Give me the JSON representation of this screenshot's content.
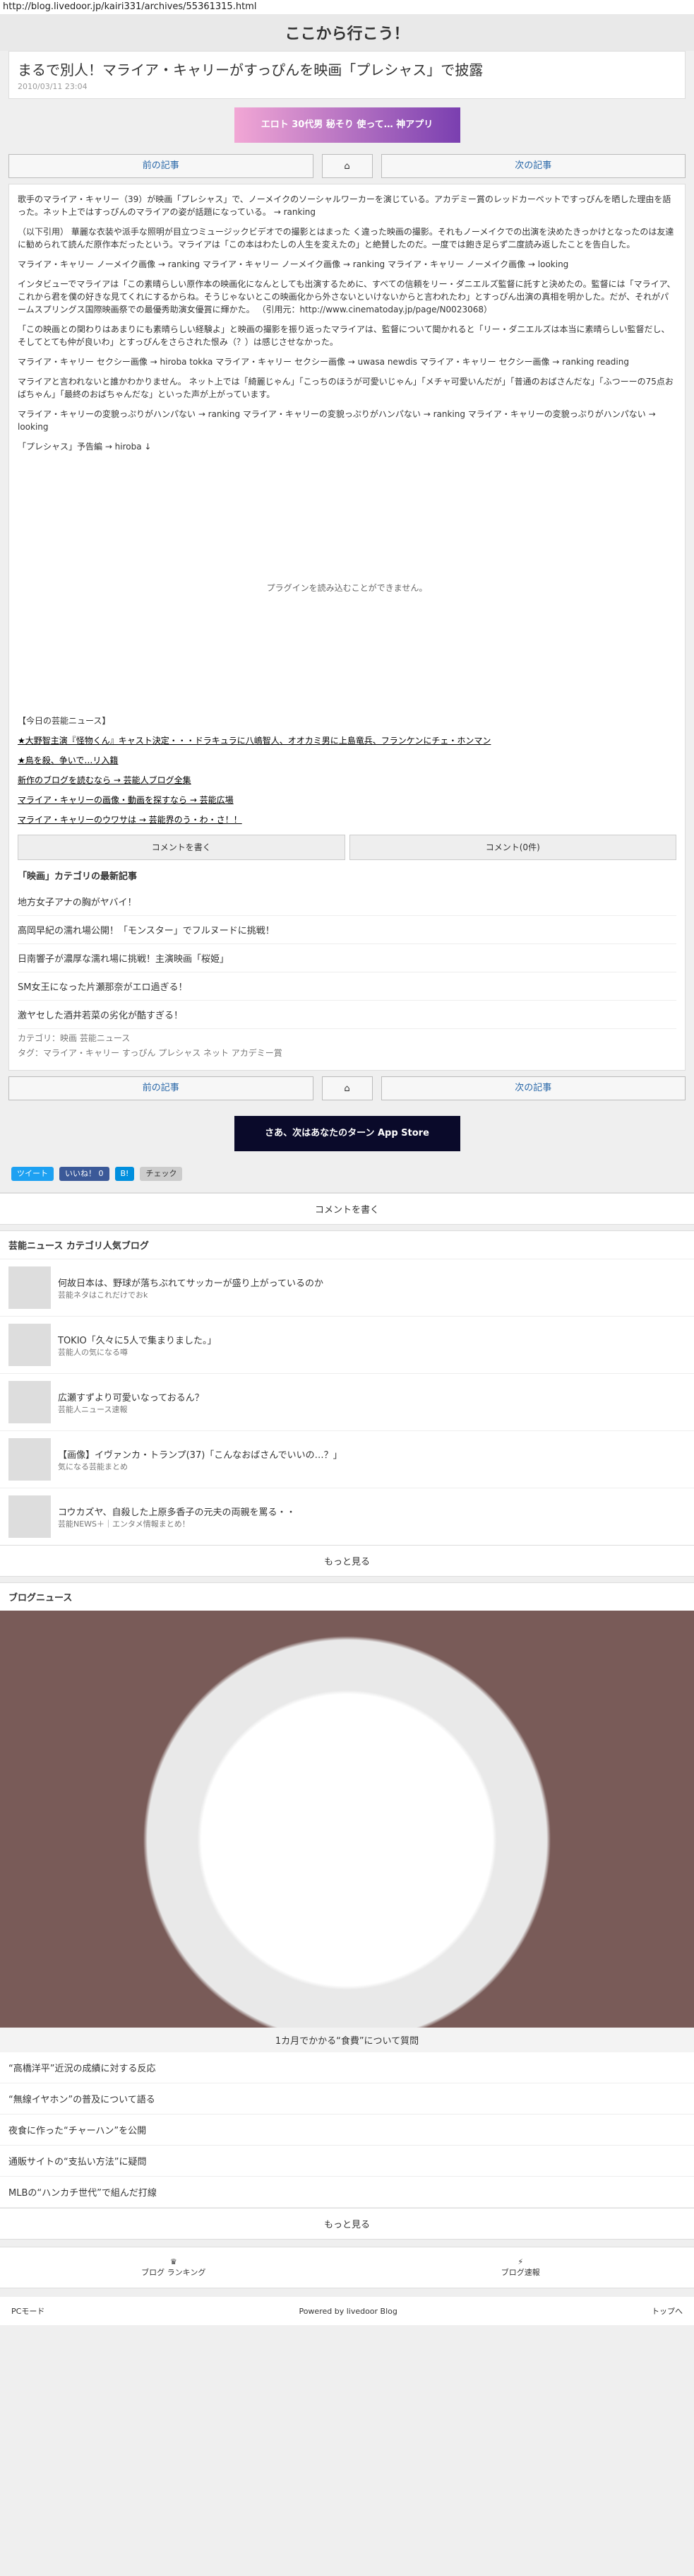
{
  "url": "http://blog.livedoor.jp/kairi331/archives/55361315.html",
  "header": "ここから行こう！",
  "title": "まるで別人！マライア・キャリーがすっぴんを映画「プレシャス」で披露",
  "date": "2010/03/11 23:04",
  "ad1": "エロト 30代男 秘そり 使って… 神アプリ",
  "prev": "前の記事",
  "next": "次の記事",
  "body": [
    "歌手のマライア・キャリー（39）が映画「プレシャス」で、ノーメイクのソーシャルワーカーを演じている。アカデミー賞のレッドカーペットですっぴんを晒した理由を語った。ネット上ではすっぴんのマライアの姿が話題になっている。 → ranking",
    "（以下引用）\n華麗な衣装や派手な照明が目立つミュージックビデオでの撮影とはまった く違った映画の撮影。それもノーメイクでの出演を決めたきっかけとなったのは友達に勧められて読んだ原作本だったという。マライアは「この本はわたしの人生を変えたの」と絶賛したのだ。一度では飽き足らず二度読み返したことを告白した。",
    "マライア・キャリー ノーメイク画像 → ranking\nマライア・キャリー ノーメイク画像 → ranking\nマライア・キャリー ノーメイク画像 → looking",
    "インタビューでマライアは「この素晴らしい原作本の映画化になんとしても出演するために、すべての信頼をリー・ダニエルズ監督に託すと決めたの。監督には「マライア、これから君を僕の好きな見てくれにするからね。そうじゃないとこの映画化から外さないといけないからと言われたわ」とすっぴん出演の真相を明かした。だが、それがパームスプリングス国際映画祭での最優秀助演女優賞に輝かた。\n（引用元：http://www.cinematoday.jp/page/N0023068）",
    "「この映画との関わりはあまりにも素晴らしい経験よ」と映画の撮影を振り返ったマライアは、監督について聞かれると「リー・ダニエルズは本当に素晴らしい監督だし、そしてとても仲が良いわ」とすっぴんをさらされた恨み（？）は感じさせなかった。",
    "マライア・キャリー セクシー画像 → hiroba tokka\nマライア・キャリー セクシー画像 → uwasa newdis\nマライア・キャリー セクシー画像 → ranking reading",
    "マライアと言われないと誰かわかりません。\nネット上では「綺麗じゃん」「こっちのほうが可愛いじゃん」「メチャ可愛いんだが」「普通のおばさんだな」「ふつーーの75点おばちゃん」「最終のおばちゃんだな」といった声が上がっています。",
    "マライア・キャリーの変貌っぷりがハンパない → ranking\nマライア・キャリーの変貌っぷりがハンパない → ranking\nマライア・キャリーの変貌っぷりがハンパない → looking",
    "「プレシャス」予告編 → hiroba\n↓"
  ],
  "video": "プラグインを読み込むことができません。",
  "news": "【今日の芸能ニュース】",
  "news1": "★大野智主演『怪物くん』キャスト決定・・・ドラキュラに八嶋智人、オオカミ男に上島竜兵、フランケンにチェ・ホンマン",
  "news2": "★鳥を殺、争いで…リ入籍",
  "links": [
    "新作のブログを読むなら → 芸能人ブログ全集",
    "マライア・キャリーの画像・動画を探すなら → 芸能広場",
    "マライア・キャリーのウワサは → 芸能界のう・わ・さ！！"
  ],
  "write": "コメントを書く",
  "comments": "コメント(0件)",
  "related_title": "「映画」カテゴリの最新記事",
  "related": [
    "地方女子アナの胸がヤバイ！",
    "高岡早紀の濡れ場公開！「モンスター」でフルヌードに挑戦！",
    "日南響子が濃厚な濡れ場に挑戦！主演映画「桜姫」",
    "SM女王になった片瀬那奈がエロ過ぎる！",
    "激ヤセした酒井若菜の劣化が酷すぎる！"
  ],
  "category": "カテゴリ：映画 芸能ニュース",
  "tags": "タグ：マライア・キャリー すっぴん プレシャス ネット アカデミー賞",
  "store": "さあ、次はあなたのターン App Store",
  "tweet": "ツイート",
  "like": "いいね！ 0",
  "b": "B!",
  "check": "チェック",
  "write2": "コメントを書く",
  "popular": "芸能ニュース カテゴリ人気ブログ",
  "blogs": [
    [
      "何故日本は、野球が落ちぶれてサッカーが盛り上がっているのか",
      "芸能ネタはこれだけでおk"
    ],
    [
      "TOKIO「久々に5人で集まりました。」",
      "芸能人の気になる噂"
    ],
    [
      "広瀬すずより可愛いなっておるん？",
      "芸能人ニュース速報"
    ],
    [
      "【画像】イヴァンカ・トランプ(37)「こんなおばさんでいいの…？」",
      "気になる芸能まとめ"
    ],
    [
      "コウカズヤ、自殺した上原多香子の元夫の両親を罵る・・",
      "芸能NEWS＋｜エンタメ情報まとめ！"
    ]
  ],
  "more": "もっと見る",
  "blognews": "ブログニュース",
  "food_caption": "1カ月でかかる“食費”について質問",
  "newslist": [
    "“高橋洋平”近況の成績に対する反応",
    "“無線イヤホン”の普及について語る",
    "夜食に作った“チャーハン”を公開",
    "通販サイトの“支払い方法”に疑問",
    "MLBの“ハンカチ世代”で組んだ打線"
  ],
  "more2": "もっと見る",
  "bottom1": "ブログ ランキング",
  "bottom2": "ブログ速報",
  "footer_left": "PCモード",
  "footer_center": "Powered by livedoor Blog",
  "footer_right": "トップへ"
}
